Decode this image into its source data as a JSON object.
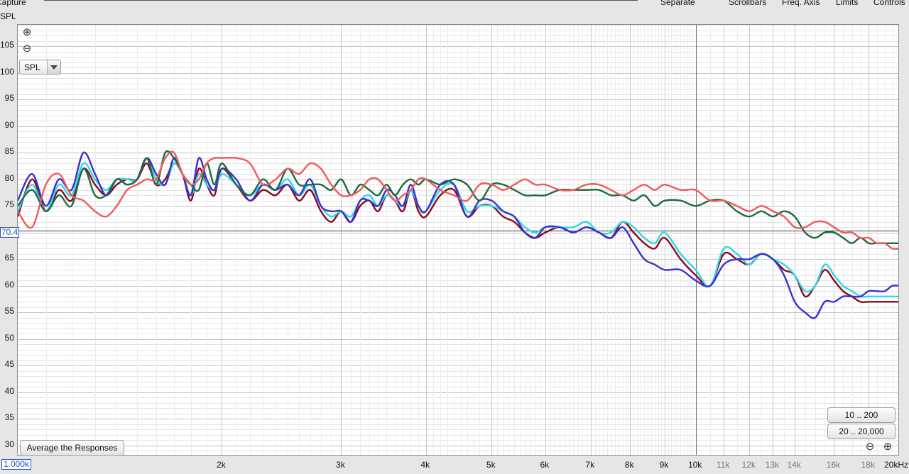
{
  "toolbar": {
    "capture_label": "Capture",
    "separate_label": "Separate",
    "scrollbars_label": "Scrollbars",
    "freq_axis_label": "Freq. Axis",
    "limits_label": "Limits",
    "controls_label": "Controls"
  },
  "y_axis_label": "SPL",
  "zoom": {
    "zoom_in_symbol": "⊕",
    "zoom_out_symbol": "⊖"
  },
  "dropdown": {
    "value": "SPL"
  },
  "cursor_value": "70.4",
  "buttons": {
    "average": "Average the Responses",
    "range_1": "10 .. 200",
    "range_2": "20 .. 20,000"
  },
  "chart_data": {
    "type": "line",
    "xlabel": "",
    "ylabel": "SPL",
    "x_scale": "log",
    "xlim": [
      1000,
      20000
    ],
    "ylim": [
      28,
      109
    ],
    "grid": true,
    "y_ticks": [
      105,
      100,
      95,
      90,
      85,
      80,
      75,
      70,
      65,
      60,
      55,
      50,
      45,
      40,
      35,
      30
    ],
    "x_ticks": [
      {
        "value": 1000,
        "label": "1.000k",
        "style": "first"
      },
      {
        "value": 2000,
        "label": "2k"
      },
      {
        "value": 3000,
        "label": "3k"
      },
      {
        "value": 4000,
        "label": "4k"
      },
      {
        "value": 5000,
        "label": "5k"
      },
      {
        "value": 6000,
        "label": "6k"
      },
      {
        "value": 7000,
        "label": "7k"
      },
      {
        "value": 8000,
        "label": "8k"
      },
      {
        "value": 9000,
        "label": "9k"
      },
      {
        "value": 10000,
        "label": "10k"
      },
      {
        "value": 11000,
        "label": "11k",
        "style": "light"
      },
      {
        "value": 12000,
        "label": "12k",
        "style": "light"
      },
      {
        "value": 13000,
        "label": "13k",
        "style": "light"
      },
      {
        "value": 14000,
        "label": "14k",
        "style": "light"
      },
      {
        "value": 16000,
        "label": "16k",
        "style": "light"
      },
      {
        "value": 18000,
        "label": "18k",
        "style": "light"
      },
      {
        "value": 20000,
        "label": "20kHz"
      }
    ],
    "reference_line_y": 70.4,
    "x": [
      1000,
      1050,
      1100,
      1150,
      1200,
      1250,
      1300,
      1350,
      1400,
      1450,
      1500,
      1550,
      1600,
      1650,
      1700,
      1750,
      1800,
      1850,
      1900,
      1950,
      2000,
      2100,
      2200,
      2300,
      2400,
      2500,
      2600,
      2700,
      2800,
      2900,
      3000,
      3100,
      3200,
      3300,
      3400,
      3500,
      3600,
      3700,
      3800,
      3900,
      4000,
      4200,
      4400,
      4600,
      4800,
      5000,
      5200,
      5400,
      5600,
      5800,
      6000,
      6300,
      6600,
      6900,
      7200,
      7500,
      7800,
      8100,
      8400,
      8700,
      9000,
      9500,
      10000,
      10500,
      11000,
      11500,
      12000,
      12500,
      13000,
      13500,
      14000,
      14500,
      15000,
      15500,
      16000,
      16500,
      17000,
      17500,
      18000,
      18500,
      19000,
      19500,
      20000
    ],
    "series": [
      {
        "color": "#8b0a1a",
        "values": [
          73,
          80,
          74,
          78,
          76,
          82,
          79,
          77,
          79,
          80,
          80,
          83,
          79,
          80,
          83,
          81,
          76,
          82,
          79,
          77,
          82,
          79,
          76,
          78,
          77,
          79,
          76,
          78,
          74,
          72,
          74,
          72,
          75,
          76,
          74,
          77,
          76,
          74,
          78,
          74,
          73,
          77,
          78,
          73,
          75,
          75,
          73,
          72,
          70,
          69,
          70,
          71,
          70,
          71,
          70,
          69,
          72,
          70,
          68,
          67,
          69,
          65,
          62,
          60,
          66,
          65,
          64,
          66,
          65,
          63,
          62,
          58,
          60,
          63,
          61,
          59,
          58,
          57,
          57,
          57,
          57,
          57,
          57
        ]
      },
      {
        "color": "#2fd8e8",
        "values": [
          74,
          79,
          74,
          79,
          77,
          83,
          80,
          78,
          80,
          80,
          80,
          84,
          80,
          79,
          83,
          81,
          77,
          81,
          79,
          78,
          81,
          79,
          77,
          79,
          78,
          80,
          77,
          79,
          75,
          73,
          74,
          73,
          76,
          77,
          75,
          77,
          76,
          75,
          78,
          75,
          74,
          78,
          79,
          74,
          75,
          75,
          74,
          73,
          71,
          70,
          71,
          71,
          71,
          72,
          70,
          70,
          72,
          71,
          69,
          68,
          70,
          66,
          63,
          60,
          67,
          66,
          64,
          66,
          65,
          64,
          62,
          59,
          60,
          64,
          62,
          60,
          59,
          58,
          58,
          58,
          58,
          58,
          58
        ]
      },
      {
        "color": "#3c2fd0",
        "values": [
          76,
          81,
          75,
          80,
          78,
          85,
          81,
          77,
          80,
          79,
          80,
          84,
          81,
          79,
          84,
          81,
          77,
          84,
          80,
          78,
          82,
          80,
          76,
          79,
          78,
          79,
          77,
          80,
          75,
          74,
          74,
          72,
          76,
          76,
          75,
          78,
          77,
          75,
          79,
          75,
          74,
          79,
          79,
          73,
          76,
          76,
          74,
          73,
          70,
          69,
          71,
          71,
          70,
          71,
          70,
          69,
          71,
          68,
          65,
          64,
          63,
          63,
          61,
          60,
          64,
          65,
          65,
          66,
          65,
          62,
          57,
          55,
          54,
          57,
          57,
          58,
          58,
          58,
          59,
          59,
          59,
          60,
          60
        ]
      },
      {
        "color": "#1e6a42",
        "values": [
          75,
          78,
          74,
          77,
          75,
          82,
          77,
          77,
          80,
          79,
          80,
          84,
          79,
          85,
          84,
          81,
          79,
          78,
          83,
          79,
          83,
          79,
          77,
          80,
          78,
          82,
          79,
          79,
          79,
          78,
          80,
          77,
          79,
          78,
          77,
          79,
          77,
          79,
          80,
          79,
          80,
          79,
          80,
          79,
          76,
          79,
          79,
          78,
          77,
          77,
          77,
          78,
          78,
          78,
          78,
          77,
          77,
          76,
          77,
          75,
          76,
          76,
          75,
          76,
          76,
          74,
          73,
          74,
          73,
          74,
          73,
          70,
          69,
          70,
          70,
          69,
          68,
          69,
          68,
          68,
          68,
          68,
          68
        ]
      },
      {
        "color": "#f05a5a",
        "values": [
          74,
          71,
          79,
          81,
          77,
          76,
          74,
          73,
          75,
          78,
          79,
          80,
          80,
          84,
          85,
          81,
          79,
          80,
          83,
          84,
          84,
          84,
          83,
          79,
          80,
          82,
          81,
          83,
          82,
          79,
          77,
          77,
          78,
          80,
          80,
          78,
          76,
          77,
          78,
          80,
          80,
          78,
          77,
          76,
          79,
          79,
          78,
          79,
          80,
          79,
          79,
          78,
          78,
          79,
          79,
          78,
          77,
          78,
          79,
          78,
          79,
          78,
          78,
          76,
          76,
          75,
          74,
          75,
          74,
          73,
          71,
          71,
          72,
          72,
          71,
          70,
          70,
          69,
          69,
          68,
          68,
          67,
          67
        ]
      }
    ]
  }
}
